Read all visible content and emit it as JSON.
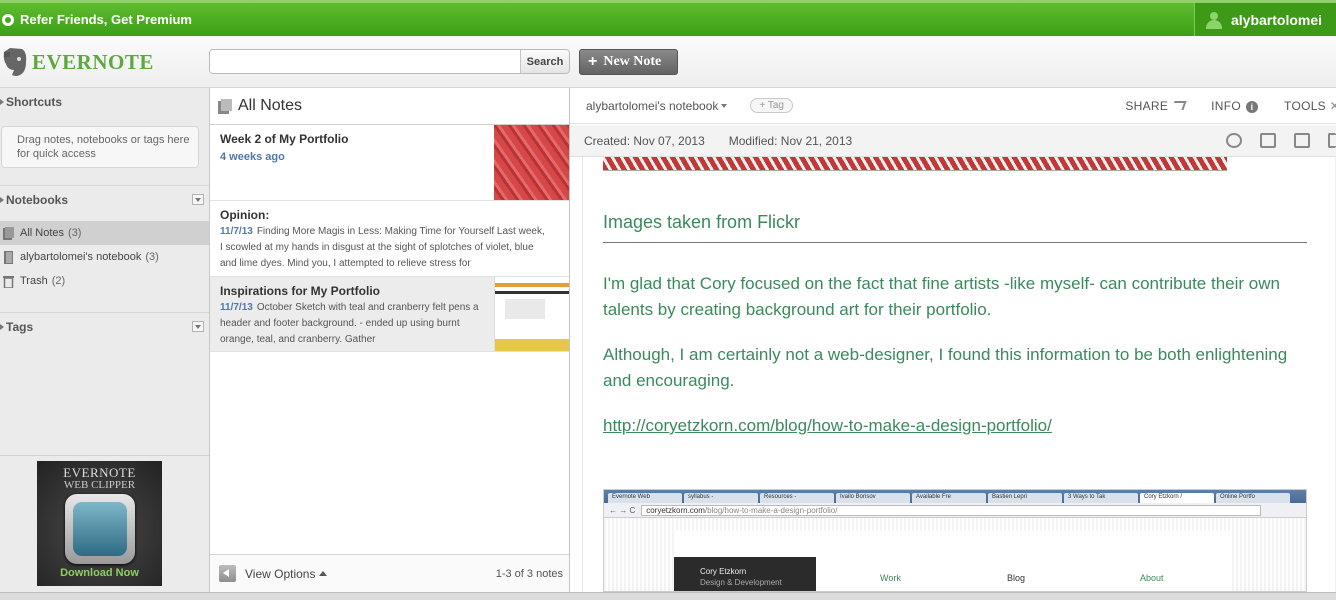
{
  "topbar": {
    "refer_label": "Refer Friends, Get Premium",
    "username": "alybartolomei"
  },
  "header": {
    "logo_text": "EVERNOTE",
    "search_placeholder": "",
    "search_button": "Search",
    "new_note_label": "New Note"
  },
  "sidebar": {
    "shortcuts_label": "Shortcuts",
    "shortcuts_hint": "Drag notes, notebooks or tags here for quick access",
    "notebooks_label": "Notebooks",
    "notebooks": [
      {
        "label": "All Notes",
        "count": "(3)"
      },
      {
        "label": "alybartolomei's notebook",
        "count": "(3)"
      },
      {
        "label": "Trash",
        "count": "(2)"
      }
    ],
    "tags_label": "Tags",
    "clipper": {
      "line1": "EVERNOTE",
      "line2": "WEB CLIPPER",
      "download": "Download Now"
    }
  },
  "notelist": {
    "title": "All Notes",
    "notes": [
      {
        "title": "Week 2 of My Portfolio",
        "date": "4 weeks ago",
        "snippet": ""
      },
      {
        "title": "Opinion:",
        "date": "11/7/13",
        "snippet": "Finding More Magis in Less: Making Time for Yourself Last week, I scowled at my hands in disgust at the sight of splotches of violet, blue and lime dyes. Mind you, I attempted to relieve stress for"
      },
      {
        "title": "Inspirations for My Portfolio",
        "date": "11/7/13",
        "snippet": "October Sketch with teal and cranberry felt pens a header and footer background. - ended up using burnt orange, teal, and cranberry. Gather"
      }
    ],
    "view_options": "View Options",
    "count_text": "1-3 of 3 notes"
  },
  "editor": {
    "notebook": "alybartolomei's notebook",
    "tag_label": "+ Tag",
    "share": "SHARE",
    "info": "INFO",
    "tools": "TOOLS",
    "created": "Created: Nov 07, 2013",
    "modified": "Modified: Nov 21, 2013",
    "heading": "Images taken from Flickr",
    "para1": "I'm glad that Cory focused on the fact that fine artists -like myself- can contribute their own talents by creating background art for their portfolio.",
    "para2": "Although, I am certainly not a web-designer, I found this information to be both enlightening and encouraging.",
    "link": "http://coryetzkorn.com/blog/how-to-make-a-design-portfolio/",
    "embedded": {
      "tabs": [
        "Evernote Web",
        "syllabus -",
        "Resources -",
        "Ivailo Borisov",
        "Available Fre",
        "Bastien Lepri",
        "3 Ways to Tak",
        "Cory Etzkorn /",
        "Online Portfo"
      ],
      "url_host": "coryetzkorn.com",
      "url_path": "/blog/how-to-make-a-design-portfolio/",
      "site_name": "Cory Etzkorn",
      "site_tagline": "Design & Development",
      "nav": [
        "Work",
        "Blog",
        "About"
      ]
    }
  },
  "colors": {
    "topbar_green": "#3d9f17",
    "note_text_green": "#3a8a5b",
    "date_blue": "#5178a8"
  }
}
